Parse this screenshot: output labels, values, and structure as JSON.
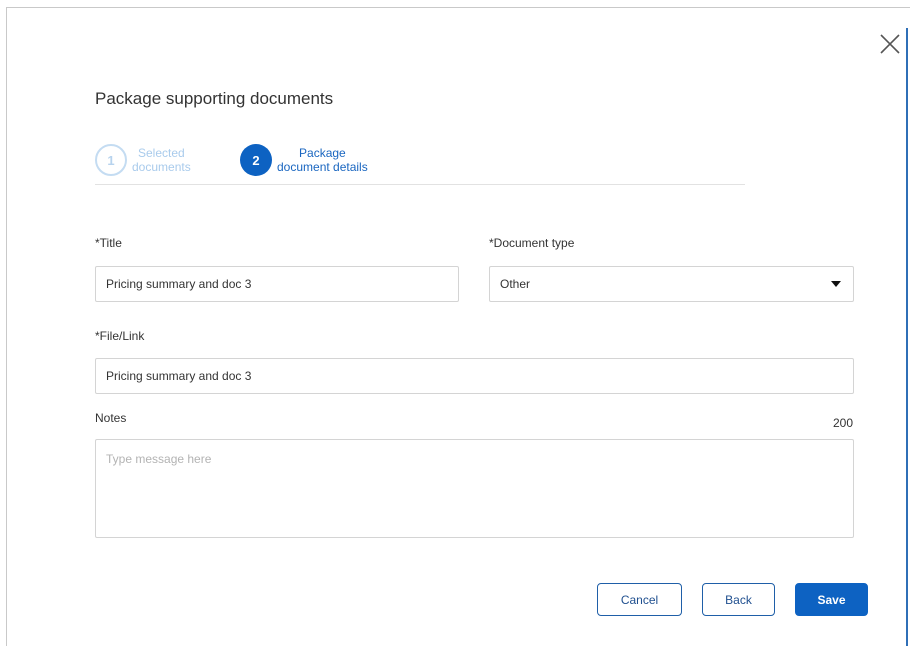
{
  "dialog": {
    "title": "Package supporting documents",
    "close_icon": "close-icon"
  },
  "stepper": {
    "steps": [
      {
        "number": "1",
        "label_line1": "Selected",
        "label_line2": "documents",
        "state": "completed"
      },
      {
        "number": "2",
        "label_line1": "Package",
        "label_line2": "document details",
        "state": "active"
      }
    ]
  },
  "form": {
    "title_label": "*Title",
    "title_value": "Pricing summary and doc 3",
    "doc_type_label": "*Document type",
    "doc_type_value": "Other",
    "file_link_label": "*File/Link",
    "file_link_value": "Pricing summary and doc 3",
    "notes_label": "Notes",
    "notes_count": "200",
    "notes_placeholder": "Type message here"
  },
  "buttons": {
    "cancel": "Cancel",
    "back": "Back",
    "save": "Save"
  },
  "colors": {
    "primary": "#0d62c2",
    "step_inactive": "#b7d3ee",
    "border": "#d4d4d4"
  }
}
